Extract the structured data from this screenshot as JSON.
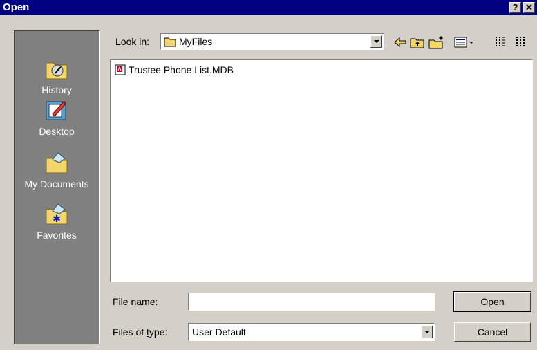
{
  "window": {
    "title": "Open",
    "help_label": "?",
    "close_label": "✕"
  },
  "places": [
    {
      "label": "History",
      "icon": "history-icon"
    },
    {
      "label": "Desktop",
      "icon": "desktop-icon"
    },
    {
      "label": "My Documents",
      "icon": "my-documents-icon"
    },
    {
      "label": "Favorites",
      "icon": "favorites-icon"
    }
  ],
  "lookin": {
    "label_pre": "Look ",
    "label_key": "i",
    "label_post": "n:",
    "value": "MyFiles"
  },
  "toolbar": [
    "back-icon",
    "up-folder-icon",
    "new-folder-icon",
    "views-icon",
    "list-view-icon",
    "details-view-icon"
  ],
  "files": [
    {
      "name": "Trustee Phone List.MDB",
      "icon": "access-db-icon"
    }
  ],
  "filename": {
    "label_pre": "File ",
    "label_key": "n",
    "label_post": "ame:",
    "value": "",
    "placeholder": ""
  },
  "filetype": {
    "label_pre": "Files of ",
    "label_key": "t",
    "label_post": "ype:",
    "value": "User Default"
  },
  "buttons": {
    "open_key": "O",
    "open_rest": "pen",
    "cancel": "Cancel"
  },
  "colors": {
    "titlebar": "#000080",
    "face": "#d4d0c8",
    "places_bg": "#808080"
  }
}
